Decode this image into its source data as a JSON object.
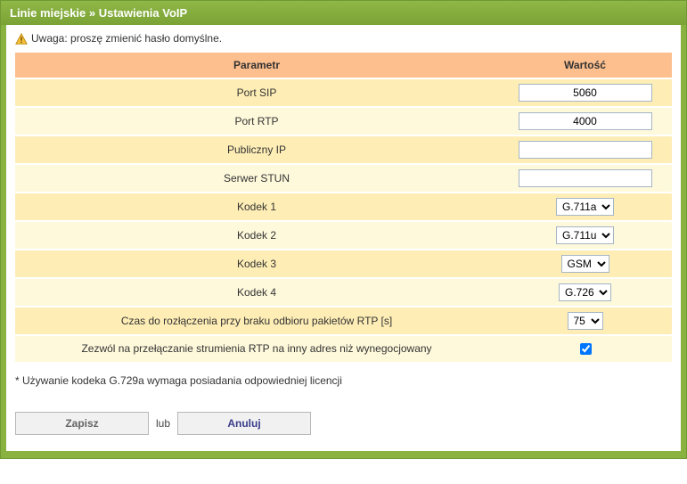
{
  "header": {
    "crumb1": "Linie miejskie",
    "sep": " » ",
    "crumb2": "Ustawienia VoIP"
  },
  "warning": {
    "text": "Uwaga: proszę zmienić hasło domyślne."
  },
  "table": {
    "col_param": "Parametr",
    "col_value": "Wartość",
    "rows": {
      "sip_port": {
        "label": "Port SIP",
        "value": "5060"
      },
      "rtp_port": {
        "label": "Port RTP",
        "value": "4000"
      },
      "public_ip": {
        "label": "Publiczny IP",
        "value": ""
      },
      "stun": {
        "label": "Serwer STUN",
        "value": ""
      },
      "codec1": {
        "label": "Kodek 1",
        "value": "G.711a"
      },
      "codec2": {
        "label": "Kodek 2",
        "value": "G.711u"
      },
      "codec3": {
        "label": "Kodek 3",
        "value": "GSM"
      },
      "codec4": {
        "label": "Kodek 4",
        "value": "G.726"
      },
      "rtp_timeout": {
        "label": "Czas do rozłączenia przy braku odbioru pakietów RTP [s]",
        "value": "75"
      },
      "rtp_switch": {
        "label": "Zezwól na przełączanie strumienia RTP na inny adres niż wynegocjowany",
        "checked": true
      }
    }
  },
  "footnote": "* Używanie kodeka G.729a wymaga posiadania odpowiedniej licencji",
  "buttons": {
    "save": "Zapisz",
    "or": "lub",
    "cancel": "Anuluj"
  }
}
